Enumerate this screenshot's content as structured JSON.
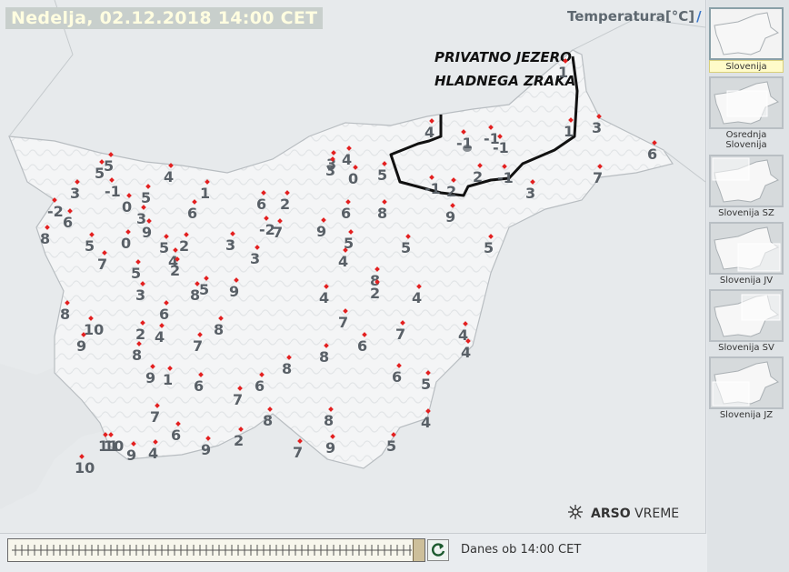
{
  "header": {
    "title": "Nedelja, 02.12.2018 14:00 CET",
    "parameter": "Temperatura[°C]",
    "close_glyph": "/"
  },
  "annotation": {
    "line1": "PRIVATNO JEZERO",
    "line2": "HLADNEGA ZRAKA"
  },
  "brand": {
    "name": "ARSO",
    "product": "VREME",
    "icon": "snowflake-sun-icon"
  },
  "sidebar": {
    "items": [
      {
        "label": "Slovenija",
        "active": true
      },
      {
        "label": "Osrednja Slovenija",
        "active": false
      },
      {
        "label": "Slovenija SZ",
        "active": false
      },
      {
        "label": "Slovenija JV",
        "active": false
      },
      {
        "label": "Slovenija SV",
        "active": false
      },
      {
        "label": "Slovenija JZ",
        "active": false
      }
    ]
  },
  "timeline": {
    "label": "Danes ob 14:00 CET",
    "refresh_icon": "refresh-icon"
  },
  "colors": {
    "station_dot": "#e32020",
    "value_text": "#596067",
    "title_bg": "#c8cfcc",
    "title_text": "#fffde0",
    "active_label_bg": "#fffbc9"
  },
  "stations": [
    {
      "v": "5"
    },
    {
      "v": "5"
    },
    {
      "v": "4"
    },
    {
      "v": "3"
    },
    {
      "v": "-1"
    },
    {
      "v": "5"
    },
    {
      "v": "1"
    },
    {
      "v": "0"
    },
    {
      "v": "3"
    },
    {
      "v": "6"
    },
    {
      "v": "-2"
    },
    {
      "v": "6"
    },
    {
      "v": "6"
    },
    {
      "v": "2"
    },
    {
      "v": "9"
    },
    {
      "v": "8"
    },
    {
      "v": "5"
    },
    {
      "v": "0"
    },
    {
      "v": "5"
    },
    {
      "v": "2"
    },
    {
      "v": "4"
    },
    {
      "v": "3"
    },
    {
      "v": "-2"
    },
    {
      "v": "7"
    },
    {
      "v": "9"
    },
    {
      "v": "5"
    },
    {
      "v": "7"
    },
    {
      "v": "2"
    },
    {
      "v": "3"
    },
    {
      "v": "5"
    },
    {
      "v": "5"
    },
    {
      "v": "3"
    },
    {
      "v": "8"
    },
    {
      "v": "3"
    },
    {
      "v": "5"
    },
    {
      "v": "4"
    },
    {
      "v": "3"
    },
    {
      "v": "4"
    },
    {
      "v": "0"
    },
    {
      "v": "5"
    },
    {
      "v": "6"
    },
    {
      "v": "8"
    },
    {
      "v": "9"
    },
    {
      "v": "4"
    },
    {
      "v": "5"
    },
    {
      "v": "8"
    },
    {
      "v": "2"
    },
    {
      "v": "4"
    },
    {
      "v": "8"
    },
    {
      "v": "10"
    },
    {
      "v": "6"
    },
    {
      "v": "2"
    },
    {
      "v": "4"
    },
    {
      "v": "9"
    },
    {
      "v": "8"
    },
    {
      "v": "7"
    },
    {
      "v": "8"
    },
    {
      "v": "7"
    },
    {
      "v": "6"
    },
    {
      "v": "7"
    },
    {
      "v": "4"
    },
    {
      "v": "4"
    },
    {
      "v": "8"
    },
    {
      "v": "9"
    },
    {
      "v": "1"
    },
    {
      "v": "6"
    },
    {
      "v": "6"
    },
    {
      "v": "8"
    },
    {
      "v": "6"
    },
    {
      "v": "5"
    },
    {
      "v": "7"
    },
    {
      "v": "7"
    },
    {
      "v": "6"
    },
    {
      "v": "8"
    },
    {
      "v": "8"
    },
    {
      "v": "4"
    },
    {
      "v": "11"
    },
    {
      "v": "10"
    },
    {
      "v": "9"
    },
    {
      "v": "4"
    },
    {
      "v": "9"
    },
    {
      "v": "2"
    },
    {
      "v": "7"
    },
    {
      "v": "9"
    },
    {
      "v": "5"
    },
    {
      "v": "10"
    },
    {
      "v": "1"
    },
    {
      "v": "3"
    },
    {
      "v": "1"
    },
    {
      "v": "6"
    },
    {
      "v": "7"
    },
    {
      "v": "4"
    },
    {
      "v": "-1"
    },
    {
      "v": "-1"
    },
    {
      "v": "-1"
    },
    {
      "v": "2"
    },
    {
      "v": "-1"
    },
    {
      "v": "3"
    },
    {
      "v": "2"
    },
    {
      "v": "-1"
    },
    {
      "v": "9"
    }
  ]
}
